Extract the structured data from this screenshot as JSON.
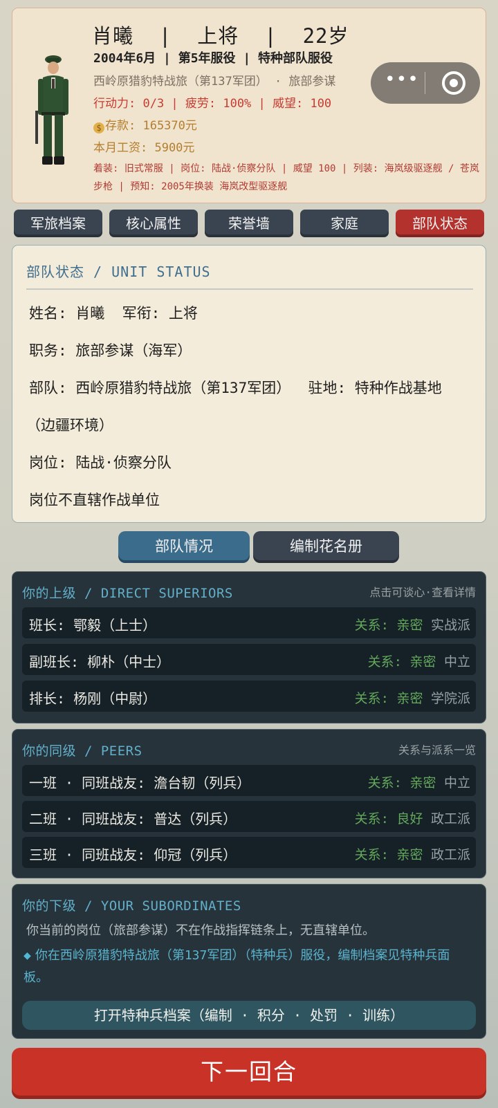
{
  "profile": {
    "name_line": "肖曦  |  上将  |  22岁",
    "service_line": "2004年6月 | 第5年服役 | 特种部队服役",
    "unit_line": "西岭原猎豹特战旅（第137军团） · 旅部参谋",
    "stats_line": "行动力: 0/3 | 疲劳: 100% | 威望: 100",
    "money_line": "存款: 165370元",
    "salary_line": "本月工资: 5900元",
    "equip_line": "着装: 旧式常服 | 岗位: 陆战·侦察分队 | 威望 100 | 列装: 海岚级驱逐舰 / 苍岚步枪 | 预知: 2005年换装 海岚改型驱逐舰",
    "avatar_label": "soldier-portrait"
  },
  "capsule": {
    "more_icon": "more-dots-icon",
    "close_icon": "target-close-icon"
  },
  "tabs": [
    {
      "label": "军旅档案"
    },
    {
      "label": "核心属性"
    },
    {
      "label": "荣誉墙"
    },
    {
      "label": "家庭"
    },
    {
      "label": "部队状态"
    }
  ],
  "status": {
    "title": "部队状态 / UNIT STATUS",
    "lines": [
      "姓名: 肖曦  军衔: 上将",
      "职务: 旅部参谋（海军）",
      "部队: 西岭原猎豹特战旅（第137军团）  驻地: 特种作战基地",
      "（边疆环境）",
      "岗位: 陆战·侦察分队",
      "岗位不直辖作战单位"
    ]
  },
  "subtabs": {
    "active": "部队情况",
    "other": "编制花名册"
  },
  "superiors": {
    "title": "你的上级 / DIRECT SUPERIORS",
    "hint": "点击可谈心·查看详情",
    "rows": [
      {
        "left": "班长: 鄂毅（上士）",
        "rel": "关系: 亲密",
        "faction": "实战派"
      },
      {
        "left": "副班长: 柳朴（中士）",
        "rel": "关系: 亲密",
        "faction": "中立"
      },
      {
        "left": "排长: 杨刚（中尉）",
        "rel": "关系: 亲密",
        "faction": "学院派"
      }
    ]
  },
  "peers": {
    "title": "你的同级 / PEERS",
    "hint": "关系与派系一览",
    "rows": [
      {
        "left": "一班 · 同班战友: 澹台韧（列兵）",
        "rel": "关系: 亲密",
        "faction": "中立"
      },
      {
        "left": "二班 · 同班战友: 普达（列兵）",
        "rel": "关系: 良好",
        "faction": "政工派"
      },
      {
        "left": "三班 · 同班战友: 仰冠（列兵）",
        "rel": "关系: 亲密",
        "faction": "政工派"
      }
    ]
  },
  "subordinates": {
    "title": "你的下级 / YOUR SUBORDINATES",
    "note": "你当前的岗位（旅部参谋）不在作战指挥链条上，无直辖单位。",
    "info": "你在西岭原猎豹特战旅（第137军团）（特种兵）服役，编制档案见特种兵面板。",
    "button": "打开特种兵档案（编制 · 积分 · 处罚 · 训练）"
  },
  "next_turn": "下一回合"
}
